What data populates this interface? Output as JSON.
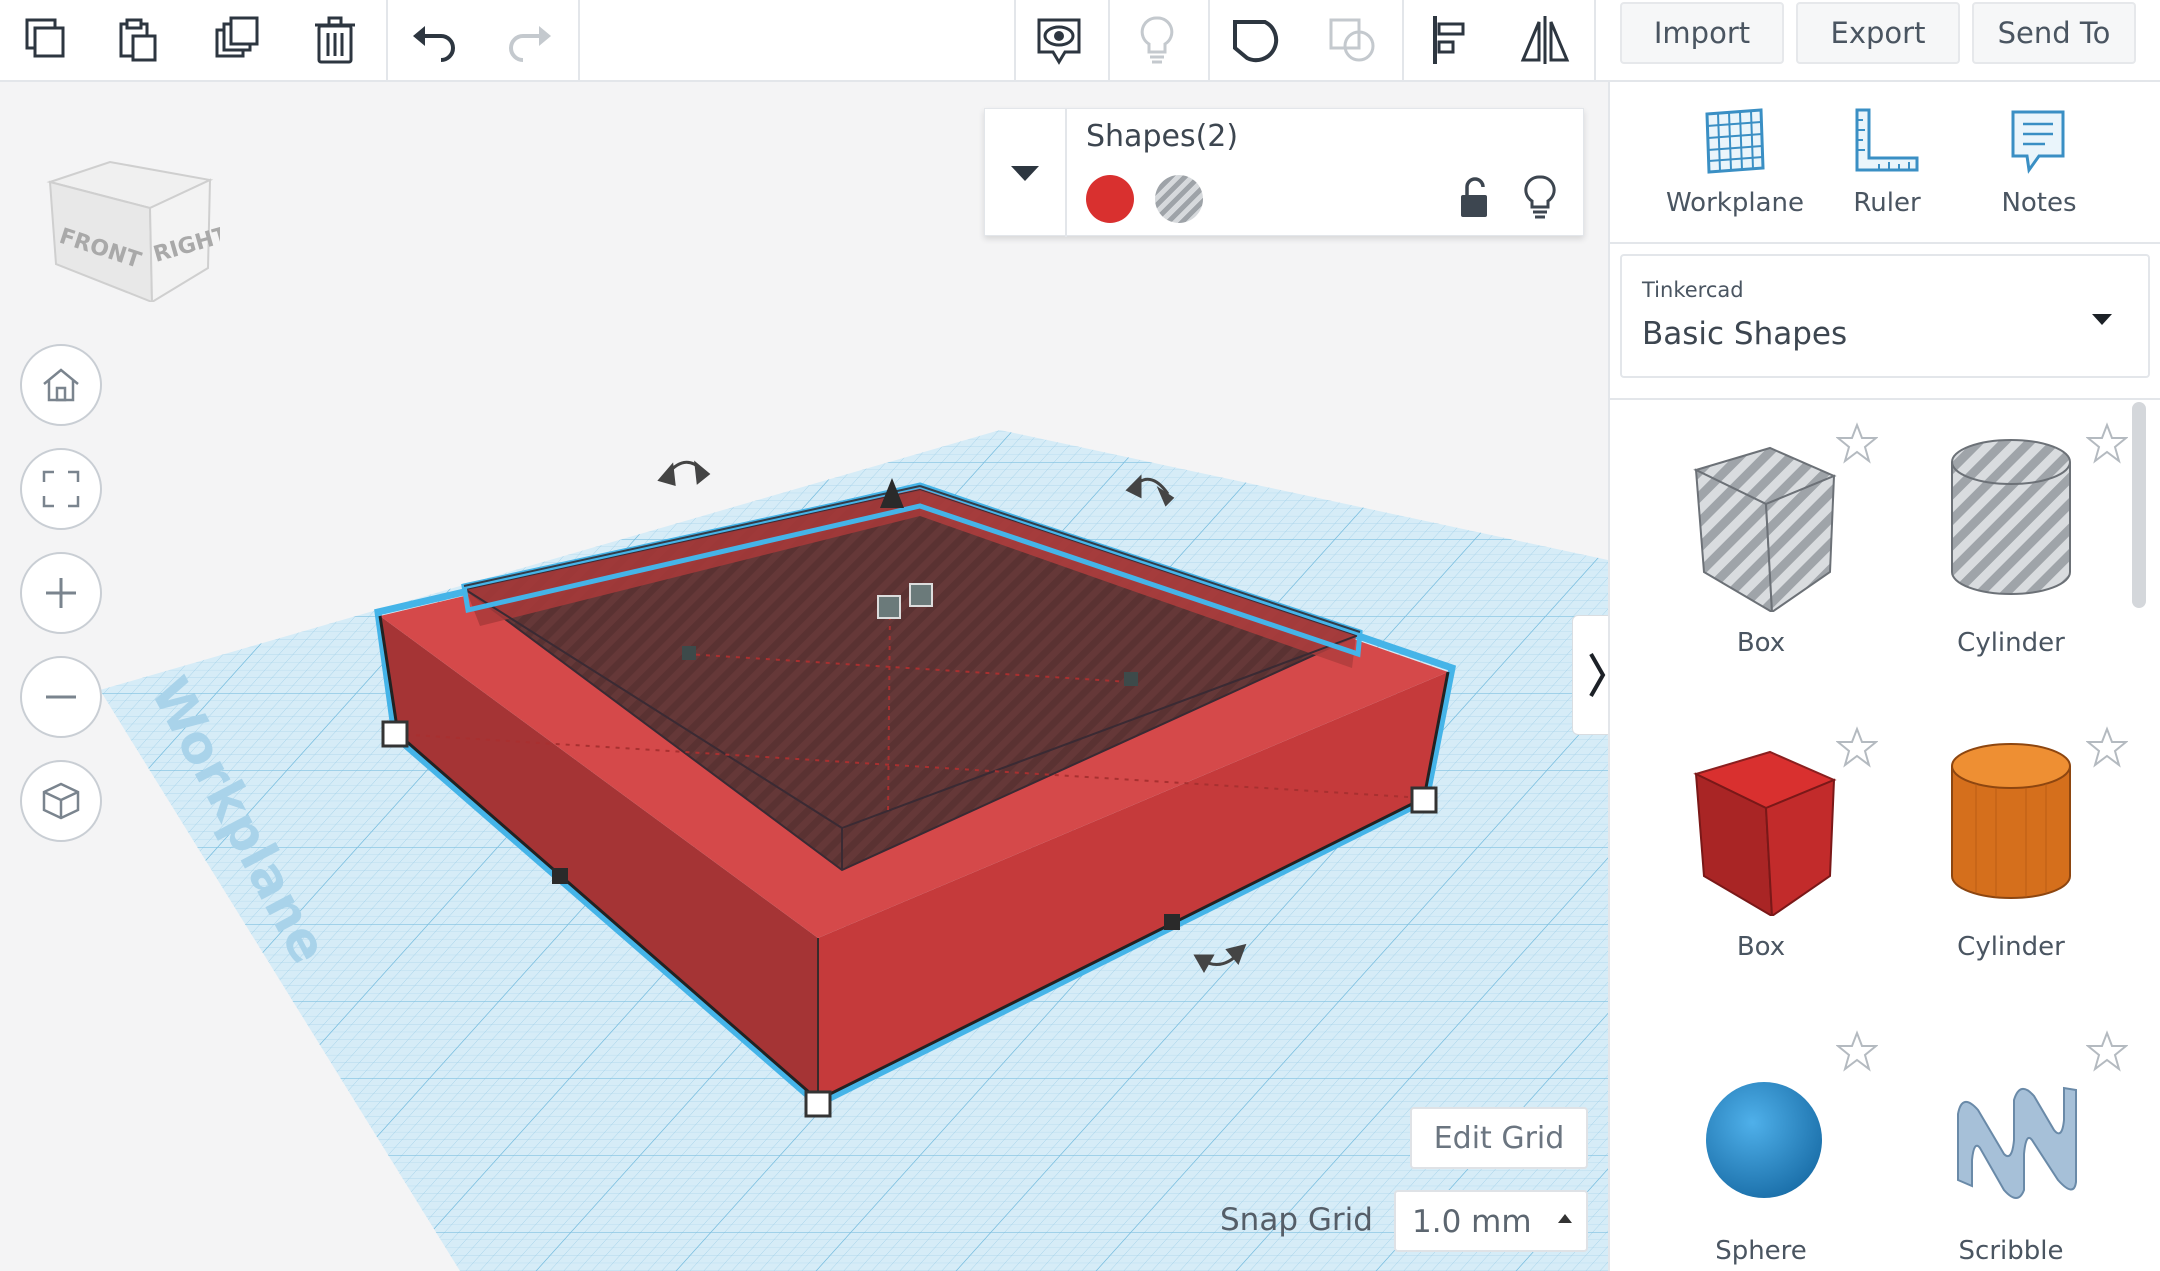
{
  "toolbar": {
    "import_label": "Import",
    "export_label": "Export",
    "send_to_label": "Send To"
  },
  "viewport": {
    "workplane_watermark": "Workplane",
    "view_cube": {
      "front": "FRONT",
      "right": "RIGHT"
    },
    "shapes_panel": {
      "title": "Shapes(2)"
    },
    "edit_grid_label": "Edit Grid",
    "snap_grid_label": "Snap Grid",
    "snap_grid_value": "1.0 mm"
  },
  "right_panel": {
    "tools": [
      {
        "label": "Workplane"
      },
      {
        "label": "Ruler"
      },
      {
        "label": "Notes"
      }
    ],
    "library": {
      "provider": "Tinkercad",
      "name": "Basic Shapes"
    },
    "shapes": [
      {
        "label": "Box"
      },
      {
        "label": "Cylinder"
      },
      {
        "label": "Box"
      },
      {
        "label": "Cylinder"
      },
      {
        "label": "Sphere"
      },
      {
        "label": "Scribble"
      }
    ]
  },
  "colors": {
    "accent": "#2aa8e0",
    "solid_red": "#d9302f",
    "orange": "#e07c2a",
    "sphere_blue": "#2f8fd0"
  }
}
